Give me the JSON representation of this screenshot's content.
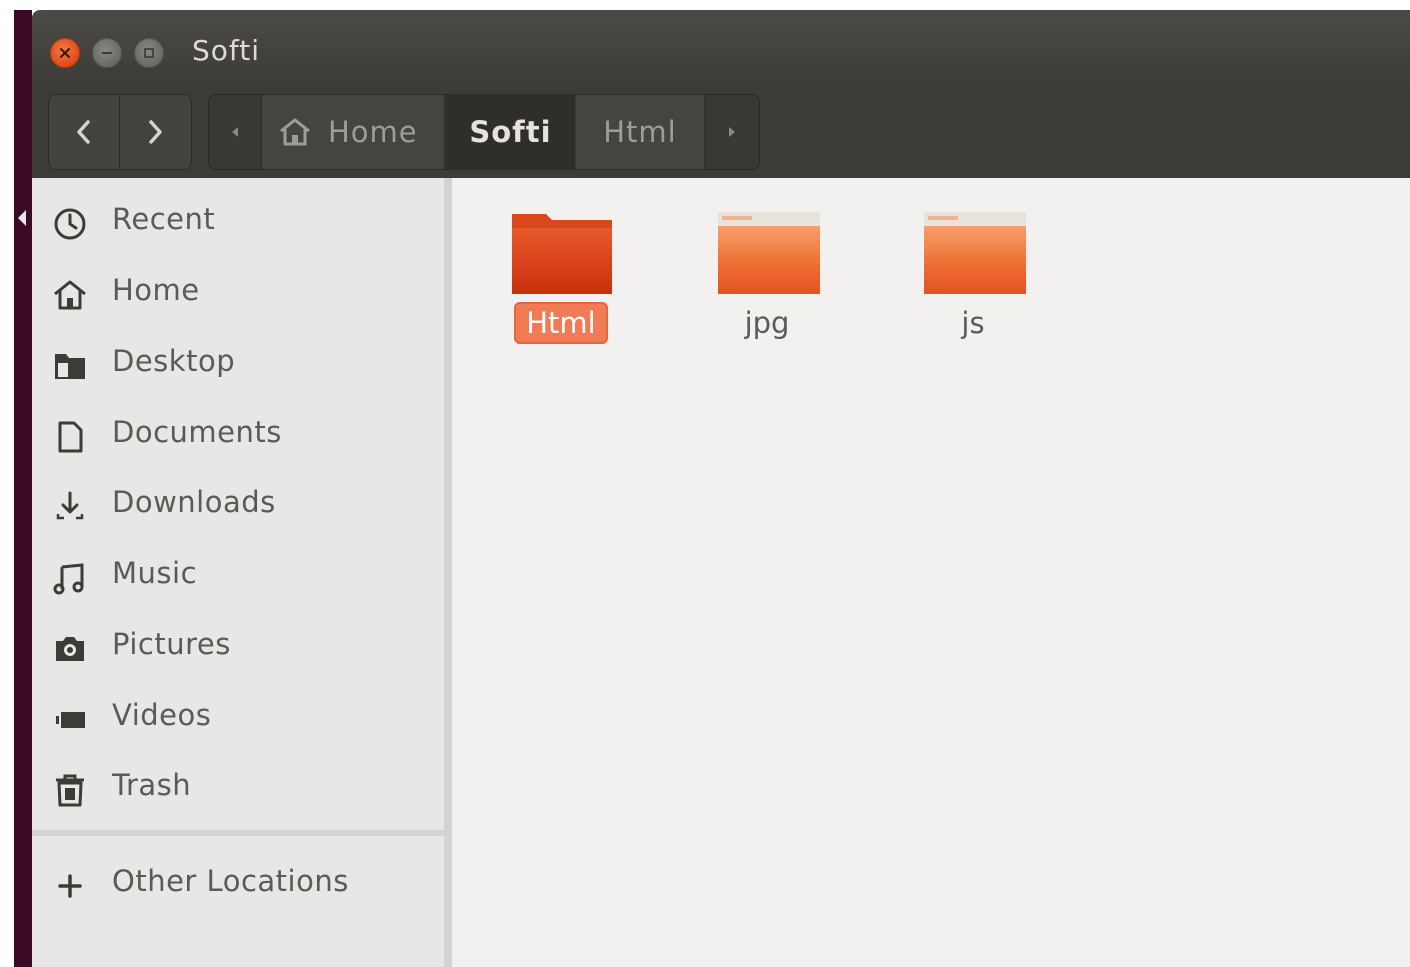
{
  "window": {
    "title": "Softi"
  },
  "pathbar": {
    "crumbs": [
      "Home",
      "Softi",
      "Html"
    ]
  },
  "sidebar": {
    "items": [
      {
        "label": "Recent",
        "icon": "clock-icon"
      },
      {
        "label": "Home",
        "icon": "home-icon"
      },
      {
        "label": "Desktop",
        "icon": "desktop-folder-icon"
      },
      {
        "label": "Documents",
        "icon": "document-icon"
      },
      {
        "label": "Downloads",
        "icon": "download-icon"
      },
      {
        "label": "Music",
        "icon": "music-icon"
      },
      {
        "label": "Pictures",
        "icon": "camera-icon"
      },
      {
        "label": "Videos",
        "icon": "video-icon"
      },
      {
        "label": "Trash",
        "icon": "trash-icon"
      }
    ],
    "other_locations": {
      "label": "Other Locations",
      "icon": "plus-icon"
    }
  },
  "files": [
    {
      "name": "Html",
      "type": "folder",
      "selected": true
    },
    {
      "name": "jpg",
      "type": "folder",
      "selected": false
    },
    {
      "name": "js",
      "type": "folder",
      "selected": false
    }
  ],
  "colors": {
    "accent": "#e95420",
    "titlebar": "#3d3b37",
    "sidebar": "#e8e7e5",
    "content": "#f2f1f0"
  }
}
